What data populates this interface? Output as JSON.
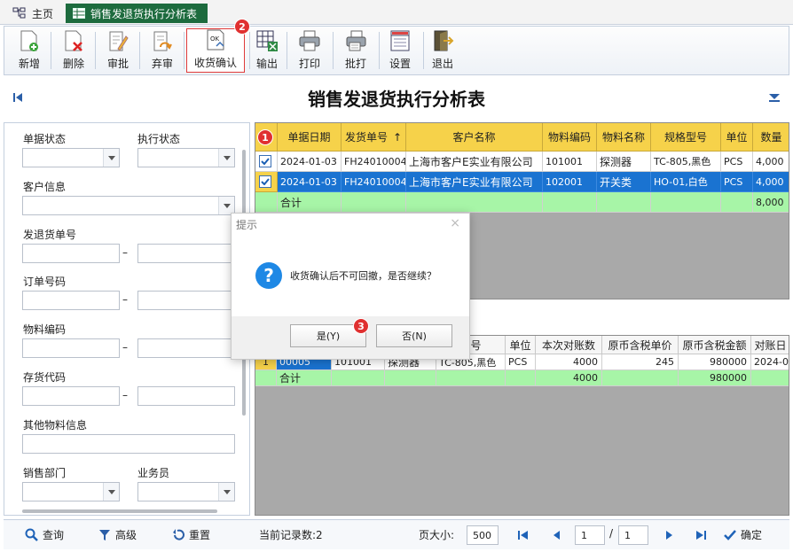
{
  "tabs": {
    "home": "主页",
    "report": "销售发退货执行分析表"
  },
  "toolbar": {
    "add": "新增",
    "delete": "删除",
    "approve": "审批",
    "unapprove": "弃审",
    "receive_confirm": "收货确认",
    "export": "输出",
    "print": "打印",
    "batch_print": "批打",
    "settings": "设置",
    "exit": "退出"
  },
  "title": "销售发退货执行分析表",
  "filters": {
    "doc_status": "单据状态",
    "exec_status": "执行状态",
    "customer_info": "客户信息",
    "shipment_no": "发退货单号",
    "order_no": "订单号码",
    "material_code": "物料编码",
    "stock_code": "存货代码",
    "other_material": "其他物料信息",
    "sales_dept": "销售部门",
    "salesman": "业务员",
    "range_dash": "–"
  },
  "grid1": {
    "headers": [
      "单据日期",
      "发货单号",
      "客户名称",
      "物料编码",
      "物料名称",
      "规格型号",
      "单位",
      "数量"
    ],
    "sort_arrow": "↑",
    "rows": [
      [
        "2024-01-03",
        "FH24010004",
        "上海市客户E实业有限公司",
        "101001",
        "探测器",
        "TC-805,黑色",
        "PCS",
        "4,000"
      ],
      [
        "2024-01-03",
        "FH24010004",
        "上海市客户E实业有限公司",
        "102001",
        "开关类",
        "HO-01,白色",
        "PCS",
        "4,000"
      ]
    ],
    "sum_label": "合计",
    "sum_qty": "8,000"
  },
  "grid2": {
    "headers": [
      "型号",
      "单位",
      "本次对账数",
      "原币含税单价",
      "原币含税金额",
      "对账日"
    ],
    "row": {
      "idx": "1",
      "code": "00005",
      "material_code": "101001",
      "name": "探测器",
      "spec": "TC-805,黑色",
      "unit": "PCS",
      "qty": "4000",
      "price": "245",
      "amount": "980000",
      "date": "2024-0"
    },
    "sum_label": "合计",
    "sum_qty": "4000",
    "sum_amount": "980000"
  },
  "dialog": {
    "title": "提示",
    "close": "×",
    "message": "收货确认后不可回撤，是否继续？",
    "yes": "是(Y)",
    "no": "否(N)"
  },
  "badges": {
    "one": "1",
    "two": "2",
    "three": "3"
  },
  "bottom": {
    "query": "查询",
    "advanced": "高级",
    "reset": "重置",
    "record_count": "当前记录数:2",
    "page_size_label": "页大小:",
    "page_size": "500",
    "page": "1",
    "slash": "/",
    "total_pages": "1",
    "confirm": "确定"
  }
}
